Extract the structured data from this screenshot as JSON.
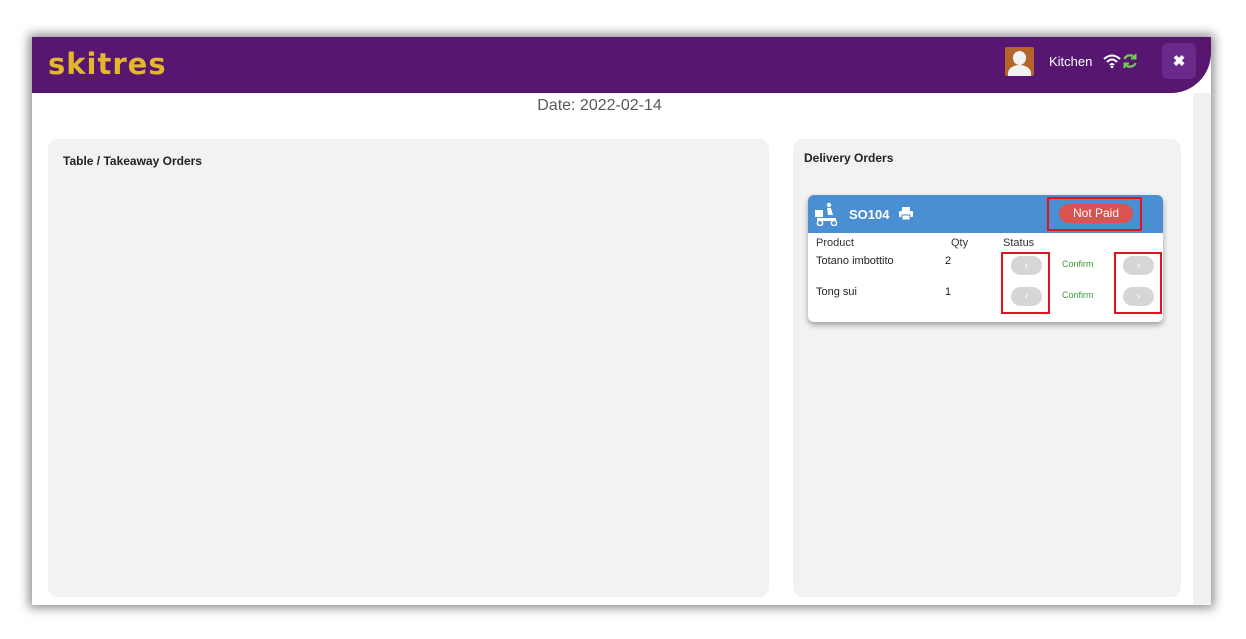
{
  "header": {
    "logo": "skitres",
    "user_name": "Kitchen",
    "close_label": "✖"
  },
  "date_line": "Date: 2022-02-14",
  "panels": {
    "table_orders_title": "Table / Takeaway Orders",
    "delivery_orders_title": "Delivery Orders"
  },
  "order": {
    "id": "SO104",
    "payment_status": "Not Paid",
    "columns": {
      "product": "Product",
      "qty": "Qty",
      "status": "Status"
    },
    "items": [
      {
        "product": "Totano imbottito",
        "qty": "2",
        "status": "Confirm",
        "prev": "‹",
        "next": "›"
      },
      {
        "product": "Tong sui",
        "qty": "1",
        "status": "Confirm",
        "prev": "‹",
        "next": "›"
      }
    ]
  },
  "icons": {
    "avatar": "user-avatar",
    "wifi": "wifi-icon",
    "sync": "sync-icon",
    "delivery": "delivery-scooter-icon",
    "print": "printer-icon"
  },
  "colors": {
    "header": "#571770",
    "logo": "#e3b62c",
    "card_header": "#4a8fd1",
    "badge": "#d9534f",
    "status_text": "#3c9b3c",
    "sync_icon": "#6fcf4f",
    "highlight": "#e0141e"
  }
}
